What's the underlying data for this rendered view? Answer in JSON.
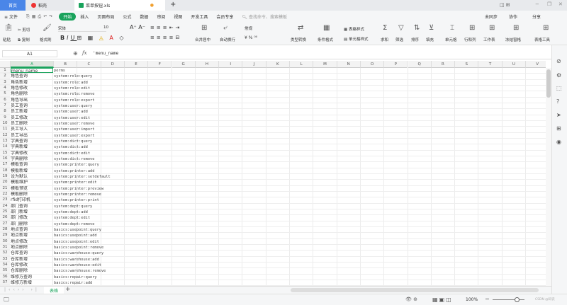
{
  "tabs": {
    "home": "首页",
    "docer": "稻壳",
    "file": "菜单按钮.xls",
    "new_tab": "+"
  },
  "window": {
    "minimize": "−",
    "restore": "❐",
    "close": "✕"
  },
  "menu": {
    "file": "文件",
    "items": [
      "开始",
      "插入",
      "页面布局",
      "公式",
      "数据",
      "审阅",
      "视图",
      "开发工具",
      "会员专享"
    ],
    "search_placeholder": "查找命令、搜索模板",
    "sync": "未同步",
    "collab": "协作",
    "share": "分享"
  },
  "toolbar": {
    "paste": "粘贴",
    "cut": "剪切",
    "copy": "复制",
    "format_painter": "格式刷",
    "font": "宋体",
    "font_size": "10",
    "merge": "合并居中",
    "wrap": "自动换行",
    "number_format": "常规",
    "type_convert": "类型转换",
    "cond_format": "条件格式",
    "table_style": "表格样式",
    "cell_style": "单元格样式",
    "sum": "求和",
    "filter": "筛选",
    "sort": "排序",
    "fill": "填充",
    "cell": "单元格",
    "row_col": "行和列",
    "worksheet": "工作表",
    "freeze": "冻结窗格",
    "table_tools": "表格工具"
  },
  "formula_bar": {
    "cell_ref": "A1",
    "fx": "fx",
    "value": "'menu_name"
  },
  "columns": [
    "A",
    "B",
    "C",
    "D",
    "E",
    "F",
    "G",
    "H",
    "I",
    "J",
    "K",
    "L",
    "M",
    "N",
    "O",
    "P",
    "Q",
    "R",
    "S",
    "T",
    "U",
    "V"
  ],
  "rows": [
    [
      "menu_name",
      "perms"
    ],
    [
      "角色查询",
      "system:role:query"
    ],
    [
      "角色新增",
      "system:role:add"
    ],
    [
      "角色修改",
      "system:role:edit"
    ],
    [
      "角色删除",
      "system:role:remove"
    ],
    [
      "角色导出",
      "system:role:export"
    ],
    [
      "员工查询",
      "system:user:query"
    ],
    [
      "员工新增",
      "system:user:add"
    ],
    [
      "员工修改",
      "system:user:edit"
    ],
    [
      "员工删除",
      "system:user:remove"
    ],
    [
      "员工导入",
      "system:user:import"
    ],
    [
      "员工导出",
      "system:user:export"
    ],
    [
      "字典查询",
      "system:dict:query"
    ],
    [
      "字典新增",
      "system:dict:add"
    ],
    [
      "字典修改",
      "system:dict:edit"
    ],
    [
      "字典删除",
      "system:dict:remove"
    ],
    [
      "模板查询",
      "system:printer:query"
    ],
    [
      "模板新增",
      "system:printer:add"
    ],
    [
      "设为默认",
      "system:printer:setdefault"
    ],
    [
      "模板维护",
      "system:printer:edit"
    ],
    [
      "模板预览",
      "system:printer:preview"
    ],
    [
      "模板删除",
      "system:printer:remove"
    ],
    [
      "rfid打印机",
      "system:printer:print"
    ],
    [
      "部门查询",
      "system:dept:query"
    ],
    [
      "部门新增",
      "system:dept:add"
    ],
    [
      "部门修改",
      "system:dept:edit"
    ],
    [
      "部门删除",
      "system:dept:remove"
    ],
    [
      "地点查询",
      "basics:usepoint:query"
    ],
    [
      "地点新增",
      "basics:usepoint:add"
    ],
    [
      "地点修改",
      "basics:usepoint:edit"
    ],
    [
      "地点删除",
      "basics:usepoint:remove"
    ],
    [
      "仓库查询",
      "basics:warehouse:query"
    ],
    [
      "仓库新增",
      "basics:warehouse:add"
    ],
    [
      "仓库修改",
      "basics:warehouse:edit"
    ],
    [
      "仓库删除",
      "basics:warehouse:remove"
    ],
    [
      "维修方查询",
      "basics:repair:query"
    ],
    [
      "维修方新增",
      "basics:repair:add"
    ]
  ],
  "sheet_tabs": [
    "表格"
  ],
  "status": {
    "zoom": "100%",
    "watermark": "CSDN @码农"
  },
  "colors": {
    "accent": "#1aa35c",
    "home_tab": "#4a86e8"
  }
}
